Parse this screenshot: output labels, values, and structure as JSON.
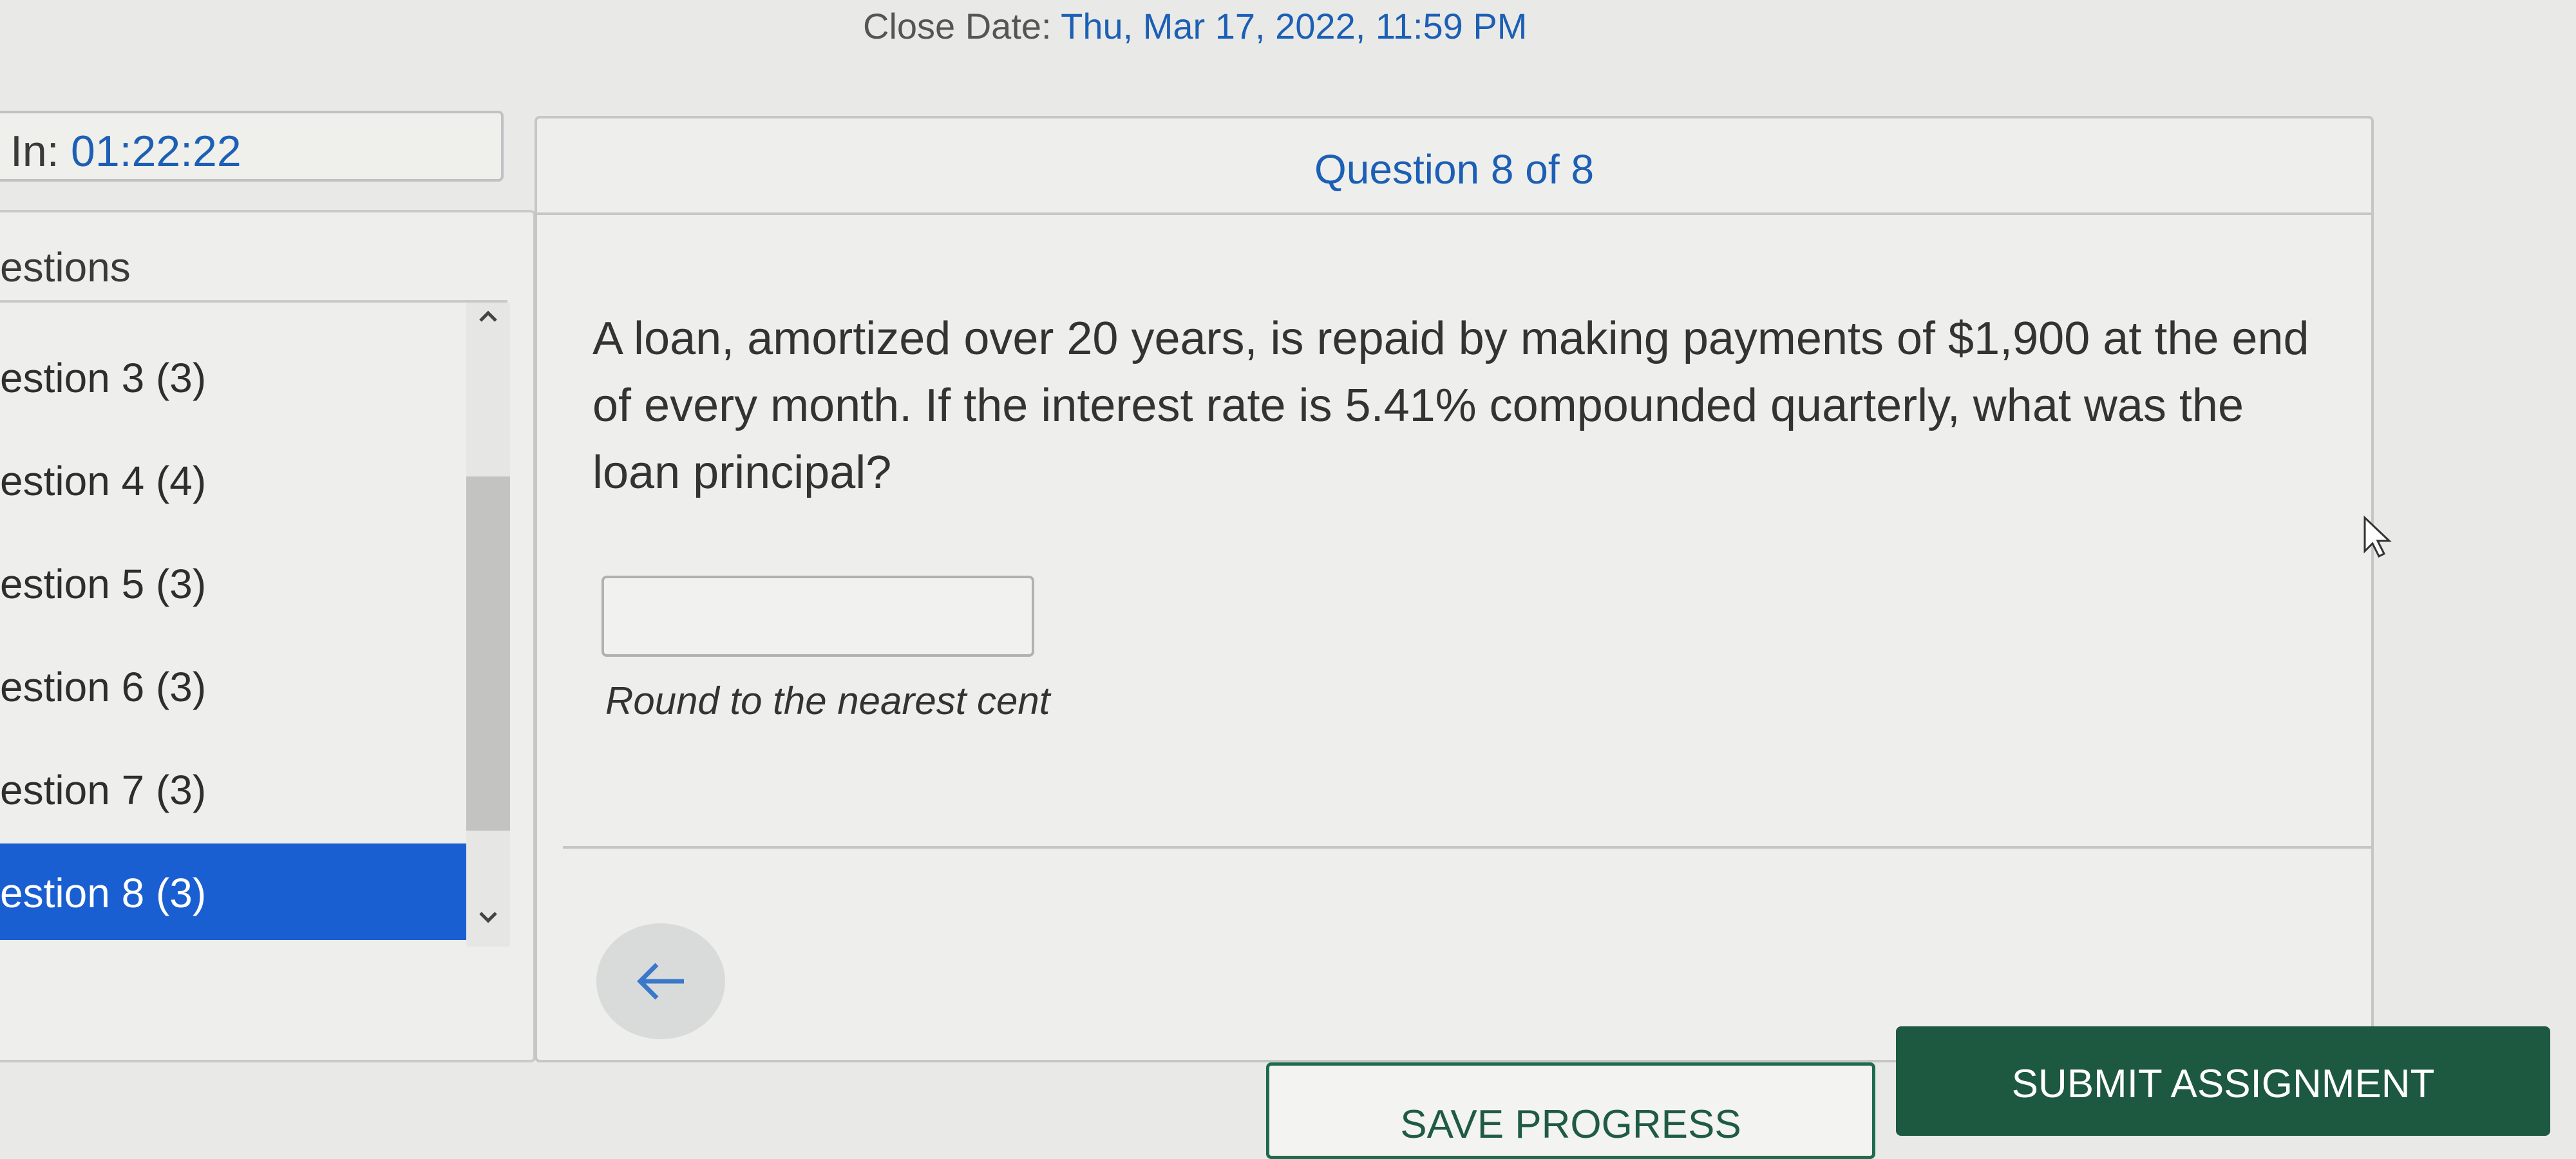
{
  "header": {
    "close_date_label": "Close Date:",
    "close_date_value": "Thu, Mar 17, 2022, 11:59 PM"
  },
  "timer": {
    "label": "In:",
    "value": "01:22:22"
  },
  "sidebar": {
    "title": "estions",
    "items": [
      {
        "label": "estion 3  (3)"
      },
      {
        "label": "estion 4  (4)"
      },
      {
        "label": "estion 5  (3)"
      },
      {
        "label": "estion 6  (3)"
      },
      {
        "label": "estion 7  (3)"
      },
      {
        "label": "estion 8  (3)"
      }
    ],
    "active_index": 5
  },
  "question": {
    "header": "Question 8 of 8",
    "text": "A loan, amortized over 20 years, is repaid by making payments of $1,900 at the end of every month. If the interest rate is 5.41% compounded quarterly, what was the loan principal?",
    "answer_value": "",
    "hint": "Round to the nearest cent"
  },
  "footer": {
    "save_label": "SAVE PROGRESS",
    "submit_label": "SUBMIT ASSIGNMENT"
  },
  "colors": {
    "link_blue": "#1c5fb5",
    "active_item": "#1a5fd1",
    "submit_green": "#1d5840"
  },
  "icons": {
    "back": "arrow-left-icon",
    "scroll_up": "chevron-up-icon",
    "scroll_down": "chevron-down-icon",
    "cursor": "mouse-pointer-icon"
  }
}
